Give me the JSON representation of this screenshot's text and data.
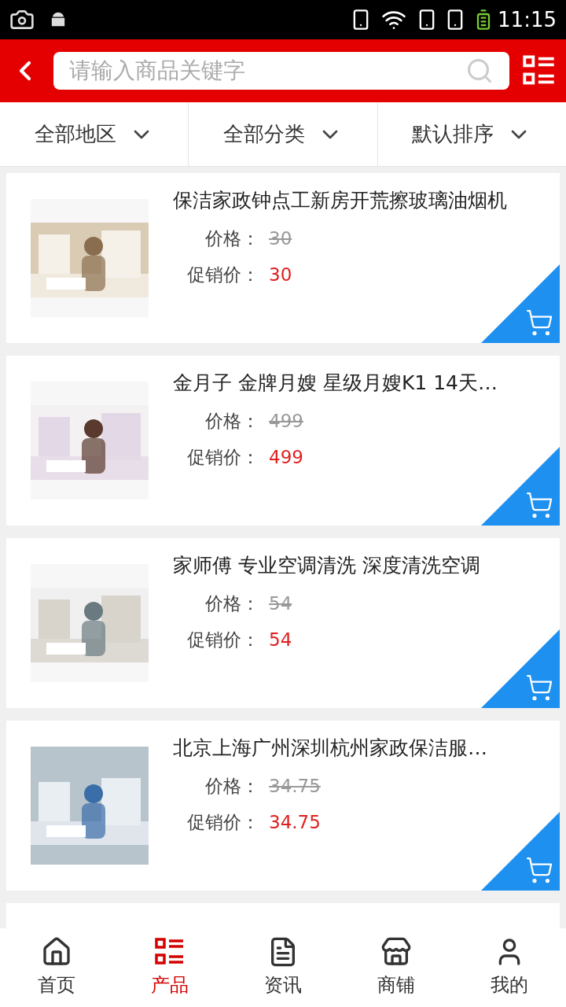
{
  "status_bar": {
    "time": "11:15"
  },
  "search": {
    "placeholder": "请输入商品关键字"
  },
  "filters": [
    {
      "label": "全部地区"
    },
    {
      "label": "全部分类"
    },
    {
      "label": "默认排序"
    }
  ],
  "products": [
    {
      "title": "保洁家政钟点工新房开荒擦玻璃油烟机",
      "price_label": "价格：",
      "price": "30",
      "promo_label": "促销价：",
      "promo_price": "30"
    },
    {
      "title": "金月子 金牌月嫂 星级月嫂K1 14天…",
      "price_label": "价格：",
      "price": "499",
      "promo_label": "促销价：",
      "promo_price": "499"
    },
    {
      "title": "家师傅 专业空调清洗 深度清洗空调",
      "price_label": "价格：",
      "price": "54",
      "promo_label": "促销价：",
      "promo_price": "54"
    },
    {
      "title": "北京上海广州深圳杭州家政保洁服…",
      "price_label": "价格：",
      "price": "34.75",
      "promo_label": "促销价：",
      "promo_price": "34.75"
    }
  ],
  "more_below": true,
  "nav": [
    {
      "label": "首页",
      "kind": "home",
      "selected": false
    },
    {
      "label": "产品",
      "kind": "list",
      "selected": true
    },
    {
      "label": "资讯",
      "kind": "news",
      "selected": false
    },
    {
      "label": "商铺",
      "kind": "shop",
      "selected": false
    },
    {
      "label": "我的",
      "kind": "user",
      "selected": false
    }
  ]
}
